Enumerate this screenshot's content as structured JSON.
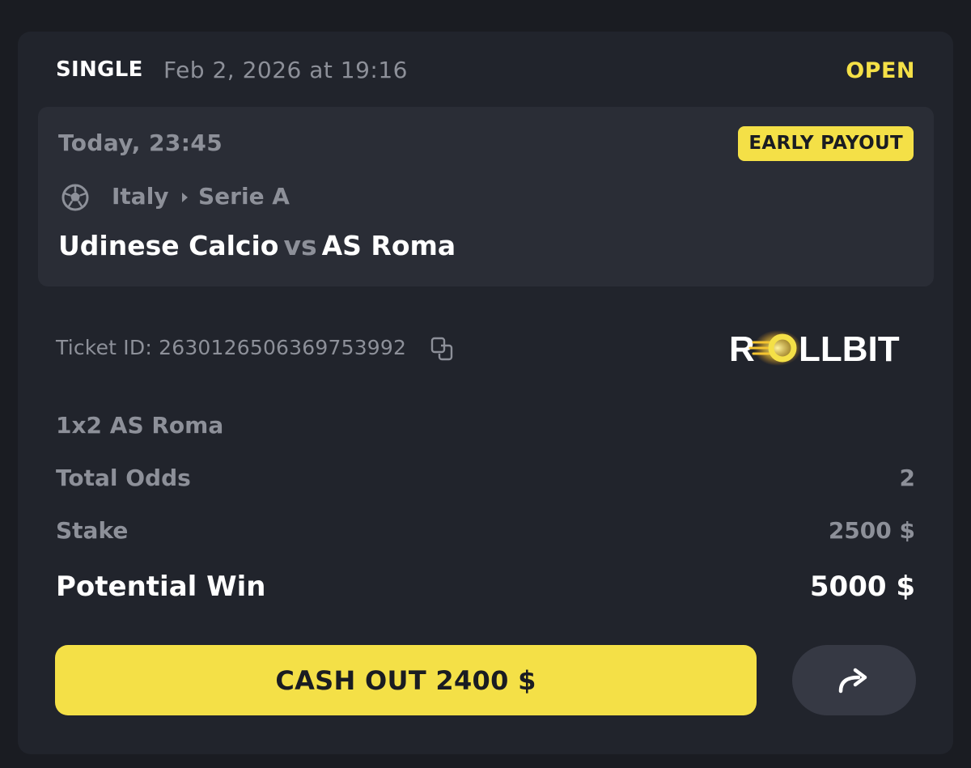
{
  "header": {
    "bet_type": "SINGLE",
    "placed_at": "Feb 2, 2026 at 19:16",
    "status": "OPEN",
    "status_color": "#f4e047"
  },
  "event": {
    "kickoff": "Today, 23:45",
    "badge": "EARLY PAYOUT",
    "sport_icon": "soccer-ball-icon",
    "country": "Italy",
    "league": "Serie A",
    "home_team": "Udinese Calcio",
    "vs": "vs",
    "away_team": "AS Roma"
  },
  "ticket": {
    "label": "Ticket ID: 2630126506369753992",
    "copy_icon": "copy-icon"
  },
  "brand": {
    "logo_text": "ROLLBIT",
    "accent": "#f4e047"
  },
  "bet": {
    "selection": "1x2 AS Roma",
    "odds_label": "Total Odds",
    "odds_value": "2",
    "stake_label": "Stake",
    "stake_value": "2500 $",
    "win_label": "Potential Win",
    "win_value": "5000 $"
  },
  "actions": {
    "cashout_label": "CASH OUT 2400 $",
    "share_icon": "share-arrow-icon"
  }
}
